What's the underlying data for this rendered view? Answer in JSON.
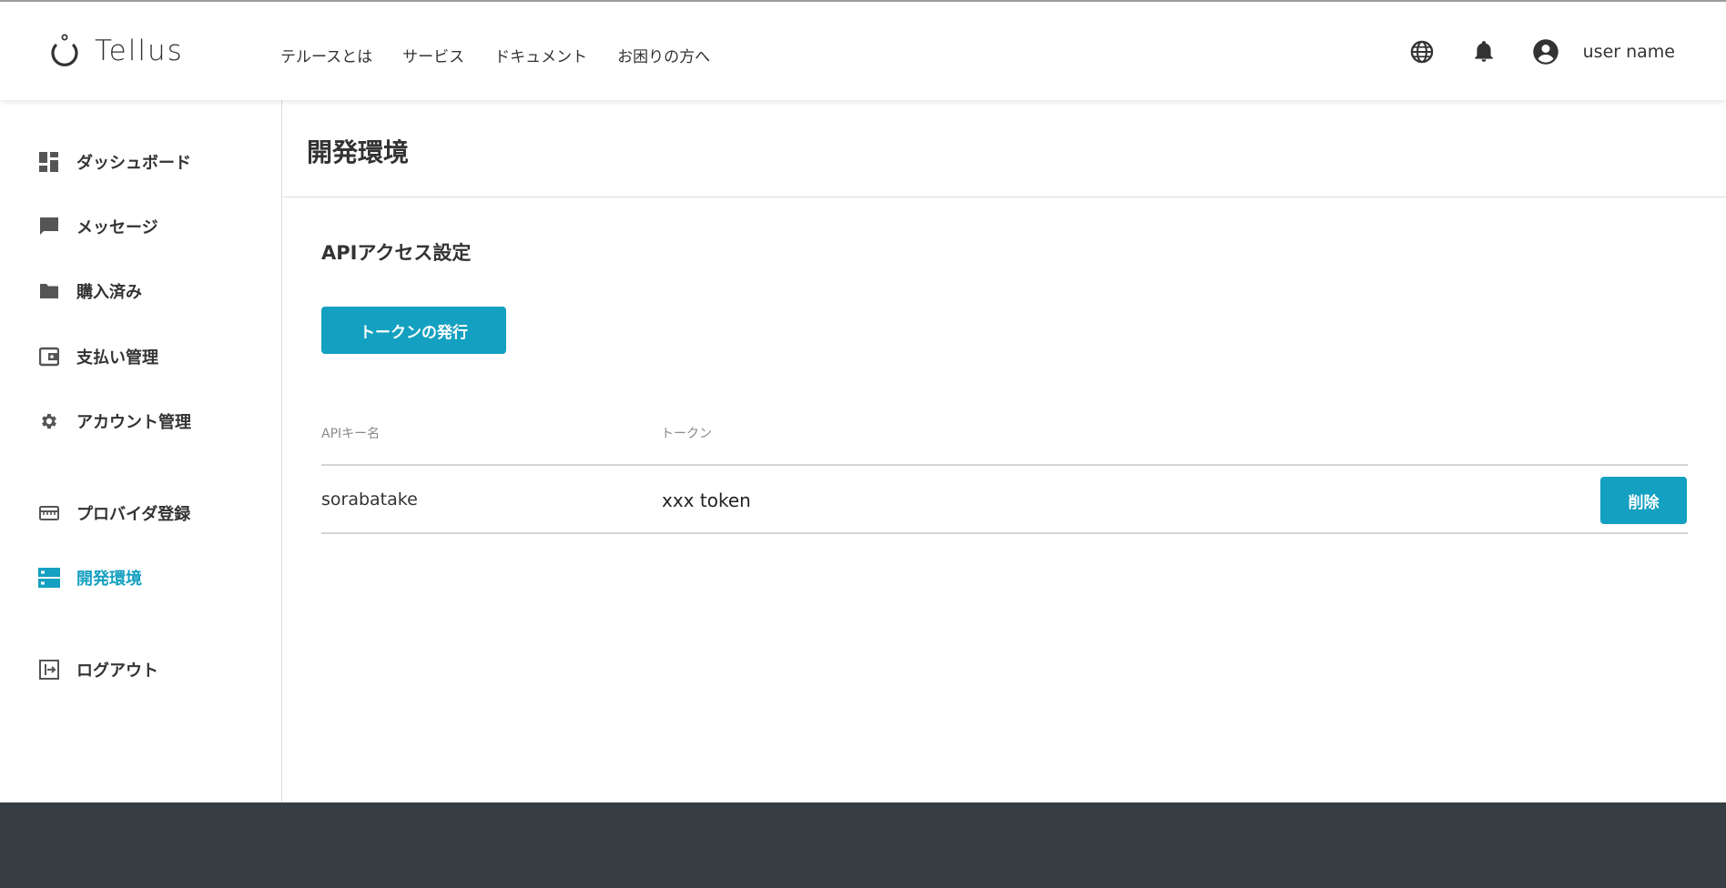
{
  "header": {
    "brand": "Tellus",
    "nav": [
      {
        "label": "テルースとは"
      },
      {
        "label": "サービス"
      },
      {
        "label": "ドキュメント"
      },
      {
        "label": "お困りの方へ"
      }
    ],
    "username": "user name"
  },
  "sidebar": {
    "items": [
      {
        "label": "ダッシュボード",
        "icon": "dashboard-icon"
      },
      {
        "label": "メッセージ",
        "icon": "message-icon"
      },
      {
        "label": "購入済み",
        "icon": "folder-icon"
      },
      {
        "label": "支払い管理",
        "icon": "wallet-icon"
      },
      {
        "label": "アカウント管理",
        "icon": "gear-icon"
      },
      {
        "label": "プロバイダ登録",
        "icon": "provider-icon"
      },
      {
        "label": "開発環境",
        "icon": "server-icon",
        "active": true
      },
      {
        "label": "ログアウト",
        "icon": "logout-icon"
      }
    ]
  },
  "main": {
    "page_title": "開発環境",
    "section_title": "APIアクセス設定",
    "issue_token_label": "トークンの発行",
    "table": {
      "columns": [
        "APIキー名",
        "トークン"
      ],
      "rows": [
        {
          "name": "sorabatake",
          "token": "xxx token",
          "action": "削除"
        }
      ]
    }
  },
  "colors": {
    "accent": "#14a0c0",
    "footer": "#373e43",
    "text": "#333333"
  }
}
